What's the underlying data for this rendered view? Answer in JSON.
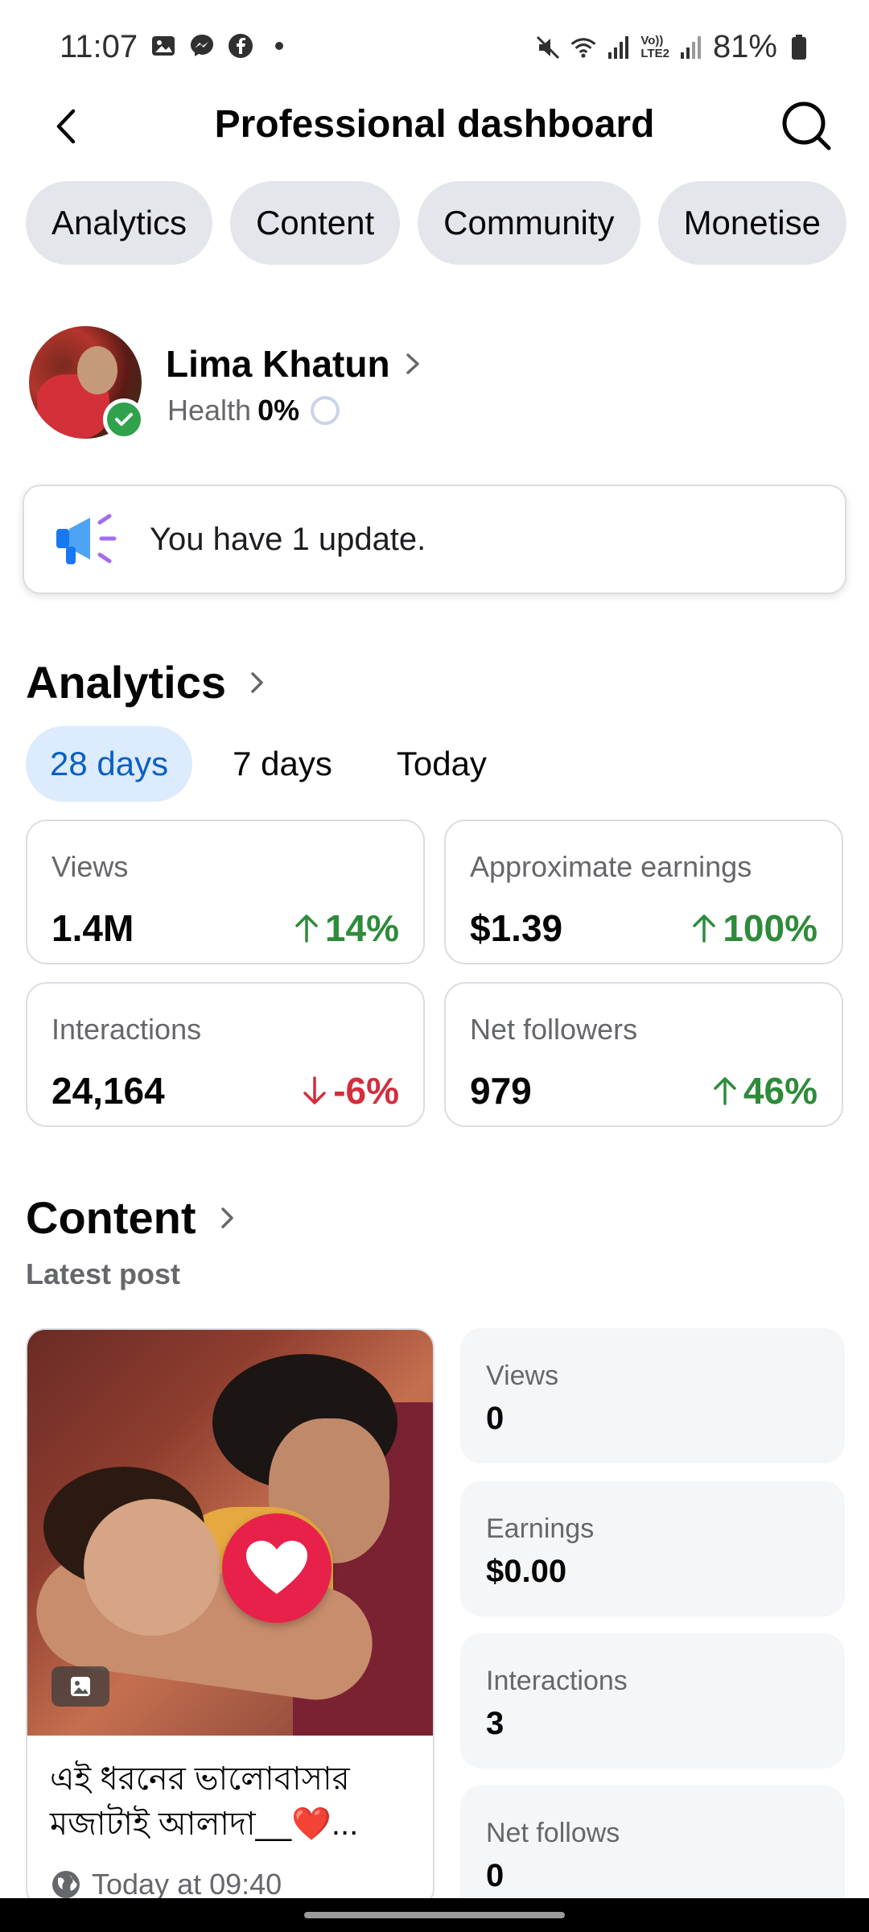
{
  "status_bar": {
    "time": "11:07",
    "battery": "81%",
    "left_icons": [
      "gallery-icon",
      "messenger-icon",
      "facebook-icon",
      "dot-icon"
    ],
    "right_icons": [
      "mute-icon",
      "wifi-icon",
      "signal-icon",
      "volte-icon",
      "signal-icon",
      "battery-icon"
    ],
    "volte_label_1": "Vo))",
    "volte_label_2": "LTE2"
  },
  "header": {
    "title": "Professional dashboard",
    "back_icon": "chevron-left-icon",
    "search_icon": "search-icon"
  },
  "tabs": [
    "Analytics",
    "Content",
    "Community",
    "Monetise"
  ],
  "profile": {
    "name": "Lima Khatun",
    "health_label": "Health",
    "health_value": "0%"
  },
  "update": {
    "text": "You have 1 update.",
    "icon": "megaphone-icon"
  },
  "analytics": {
    "title": "Analytics",
    "ranges": [
      "28 days",
      "7 days",
      "Today"
    ],
    "active_range": "28 days",
    "stats": [
      {
        "label": "Views",
        "value": "1.4M",
        "change": "14%",
        "direction": "up"
      },
      {
        "label": "Approximate earnings",
        "value": "$1.39",
        "change": "100%",
        "direction": "up"
      },
      {
        "label": "Interactions",
        "value": "24,164",
        "change": "-6%",
        "direction": "down"
      },
      {
        "label": "Net followers",
        "value": "979",
        "change": "46%",
        "direction": "up"
      }
    ]
  },
  "content": {
    "title": "Content",
    "latest_post_label": "Latest post",
    "post": {
      "caption": "এই ধরনের ভালোবাসার মজাটাই আলাদা__❤️...",
      "time": "Today at 09:40"
    },
    "metrics": [
      {
        "label": "Views",
        "value": "0"
      },
      {
        "label": "Earnings",
        "value": "$0.00"
      },
      {
        "label": "Interactions",
        "value": "3"
      },
      {
        "label": "Net follows",
        "value": "0"
      }
    ]
  },
  "colors": {
    "accent_blue": "#0b5fc4",
    "positive": "#2e8b3a",
    "negative": "#d22e3c",
    "chip_bg": "#e4e6eb"
  }
}
